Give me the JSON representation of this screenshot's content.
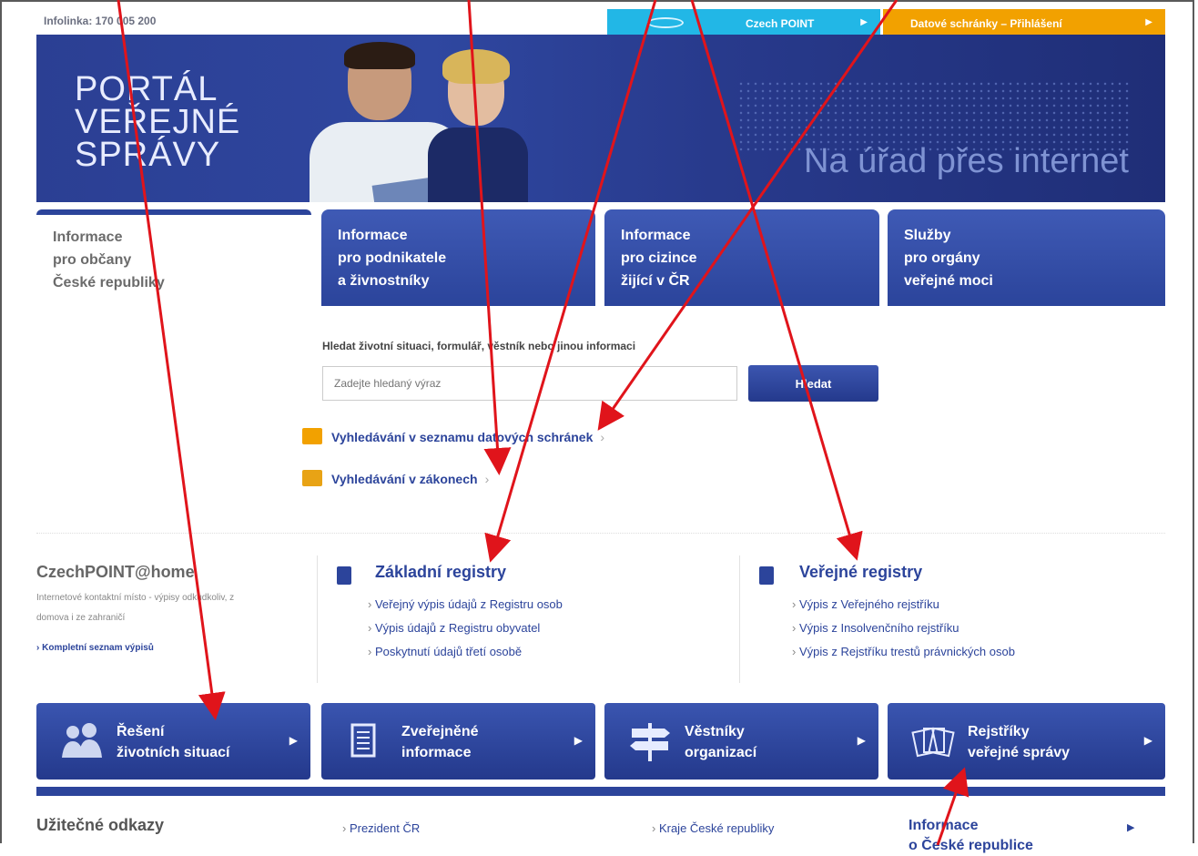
{
  "topbar": {
    "infolink": "Infolinka: 170 005 200",
    "czechpoint_label": "Czech POINT",
    "datove_label": "Datové schránky – Přihlášení"
  },
  "banner": {
    "title_lines": [
      "PORTÁL",
      "VEŘEJNÉ",
      "SPRÁVY"
    ],
    "tagline": "Na úřad přes internet"
  },
  "tabs": [
    {
      "lines": [
        "Informace",
        "pro občany",
        "České republiky"
      ]
    },
    {
      "lines": [
        "Informace",
        "pro podnikatele",
        "a živnostníky"
      ]
    },
    {
      "lines": [
        "Informace",
        "pro cizince",
        "žijící v ČR"
      ]
    },
    {
      "lines": [
        "Služby",
        "pro orgány",
        "veřejné moci"
      ]
    }
  ],
  "search": {
    "label": "Hledat životní situaci, formulář, věstník nebo jinou informaci",
    "placeholder": "Zadejte hledaný výraz",
    "button": "Hledat"
  },
  "quick_links": [
    {
      "label": "Vyhledávání v seznamu datových schránek",
      "chev": "›"
    },
    {
      "label": "Vyhledávání v zákonech",
      "chev": "›"
    }
  ],
  "czechpoint_home": {
    "title": "CzechPOINT@home",
    "desc": "Internetové kontaktní místo - výpisy odkudkoliv, z domova i ze zahraničí",
    "link": "› Kompletní seznam výpisů"
  },
  "zakladni_registry": {
    "title": "Základní registry",
    "items": [
      "Veřejný výpis údajů z Registru osob",
      "Výpis údajů z Registru obyvatel",
      "Poskytnutí údajů třetí osobě"
    ]
  },
  "verejne_registry": {
    "title": "Veřejné registry",
    "items": [
      "Výpis z Veřejného rejstříku",
      "Výpis z Insolvenčního rejstříku",
      "Výpis z Rejstříku trestů právnických osob"
    ]
  },
  "big_buttons": [
    {
      "lines": [
        "Řešení",
        "životních situací"
      ],
      "icon": "people-icon"
    },
    {
      "lines": [
        "Zveřejněné",
        "informace"
      ],
      "icon": "document-icon"
    },
    {
      "lines": [
        "Věstníky",
        "organizací"
      ],
      "icon": "signpost-icon"
    },
    {
      "lines": [
        "Rejstříky",
        "veřejné správy"
      ],
      "icon": "papers-icon"
    }
  ],
  "footer": {
    "title": "Užitečné odkazy",
    "links": [
      "Prezident ČR",
      "Kraje České republiky"
    ],
    "info_lines": [
      "Informace",
      "o České republice"
    ]
  },
  "colors": {
    "brand_blue": "#2c449b",
    "czechpoint": "#22b7e6",
    "datove": "#f2a100",
    "annotation_arrow": "#e0141b"
  }
}
